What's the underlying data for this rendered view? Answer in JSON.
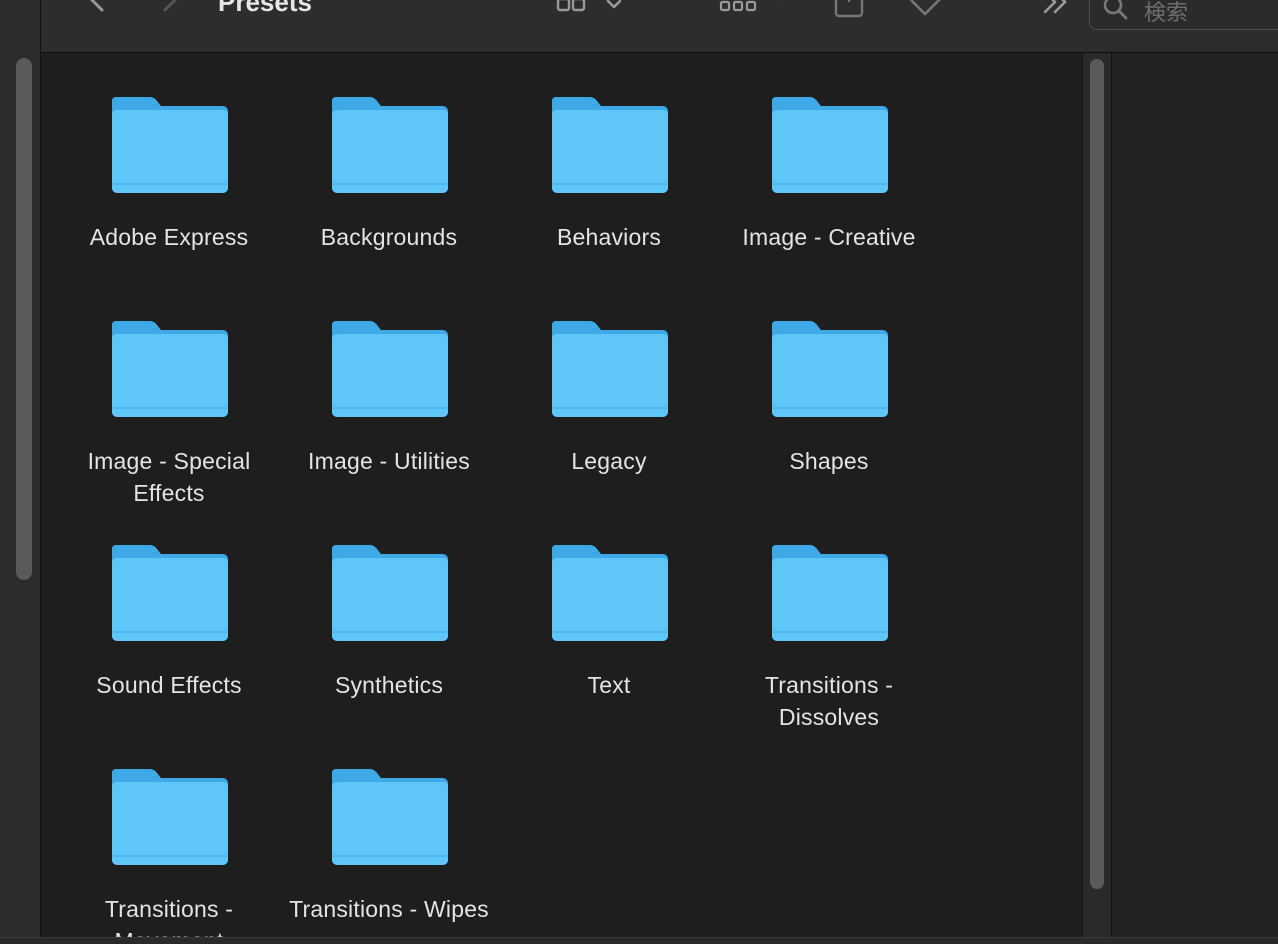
{
  "toolbar": {
    "title": "Presets",
    "search_placeholder": "検索",
    "icons": [
      "back-icon",
      "forward-icon",
      "view-icon-grid",
      "group-icon",
      "share-icon",
      "tag-icon",
      "more-icon",
      "search-icon"
    ]
  },
  "folder_color": "#5ec7f8",
  "folders": [
    {
      "label": "Adobe Express"
    },
    {
      "label": "Backgrounds"
    },
    {
      "label": "Behaviors"
    },
    {
      "label": "Image - Creative"
    },
    {
      "label": "Image - Special Effects"
    },
    {
      "label": "Image - Utilities"
    },
    {
      "label": "Legacy"
    },
    {
      "label": "Shapes"
    },
    {
      "label": "Sound Effects"
    },
    {
      "label": "Synthetics"
    },
    {
      "label": "Text"
    },
    {
      "label": "Transitions - Dissolves"
    },
    {
      "label": "Transitions - Movement"
    },
    {
      "label": "Transitions - Wipes"
    }
  ]
}
